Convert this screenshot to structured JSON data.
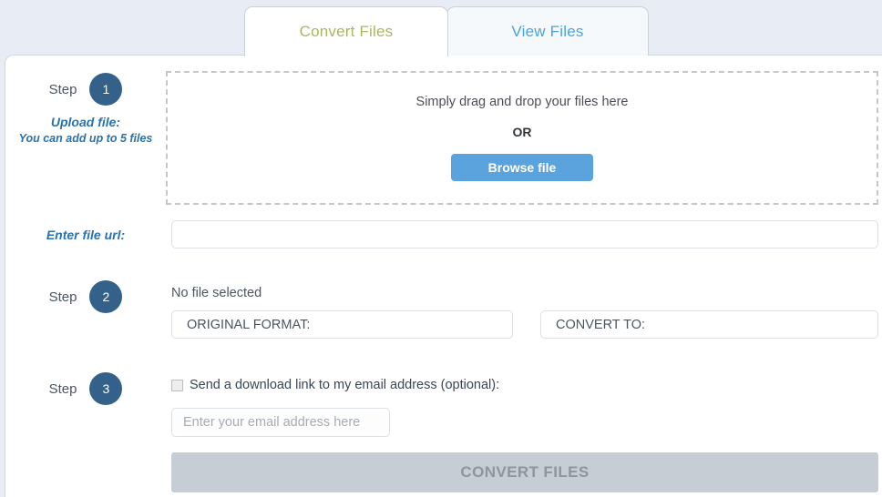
{
  "tabs": [
    {
      "id": "convert",
      "label": "Convert Files",
      "active": true
    },
    {
      "id": "view",
      "label": "View Files",
      "active": false
    }
  ],
  "steps": {
    "word": "Step",
    "one": {
      "number": "1",
      "title": "Upload file:",
      "subtitle": "You can add up to 5 files"
    },
    "two": {
      "number": "2"
    },
    "three": {
      "number": "3"
    }
  },
  "dropzone": {
    "hint": "Simply drag and drop your files here",
    "or": "OR",
    "browse_label": "Browse file"
  },
  "file_url": {
    "label": "Enter file url:",
    "value": "",
    "placeholder": ""
  },
  "step2": {
    "no_file_text": "No file selected",
    "original_format_label": "ORIGINAL FORMAT:",
    "convert_to_label": "CONVERT TO:"
  },
  "step3": {
    "optin_label": "Send a download link to my email address (optional):",
    "checkbox_checked": false,
    "email_value": "",
    "email_placeholder": "Enter your email address here"
  },
  "submit": {
    "label": "CONVERT FILES",
    "enabled": false
  },
  "colors": {
    "page_background": "#e8edf5",
    "card_background": "#ffffff",
    "active_tab_text": "#a9b860",
    "inactive_tab_text": "#4ba3dd",
    "step_circle": "#33618a",
    "side_label": "#2b72ab",
    "browse_button": "#5ba3dc",
    "submit_disabled": "#c7cdd4",
    "submit_disabled_text": "#8e959c"
  }
}
